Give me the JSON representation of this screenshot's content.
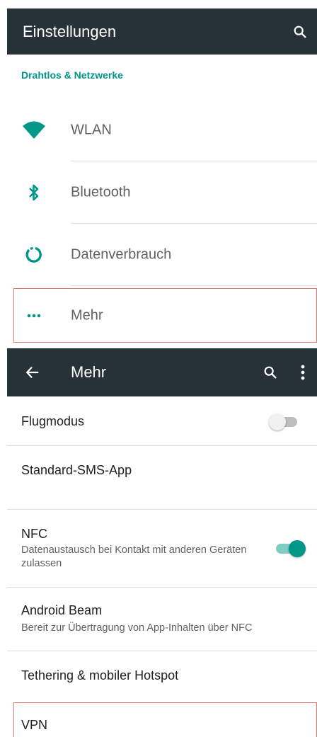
{
  "settings_screen": {
    "title": "Einstellungen",
    "search_icon": "search-icon",
    "section_header": "Drahtlos & Netzwerke",
    "items": [
      {
        "label": "WLAN",
        "icon": "wifi-icon"
      },
      {
        "label": "Bluetooth",
        "icon": "bluetooth-icon"
      },
      {
        "label": "Datenverbrauch",
        "icon": "data-usage-icon"
      },
      {
        "label": "Mehr",
        "icon": "more-horiz-icon"
      }
    ]
  },
  "more_screen": {
    "title": "Mehr",
    "back_icon": "arrow-back-icon",
    "search_icon": "search-icon",
    "overflow_icon": "more-vert-icon",
    "items": [
      {
        "title": "Flugmodus",
        "toggle": false
      },
      {
        "title": "Standard-SMS-App"
      },
      {
        "title": "NFC",
        "summary": "Datenaustausch bei Kontakt mit anderen Geräten zulassen",
        "toggle": true
      },
      {
        "title": "Android Beam",
        "summary": "Bereit zur Übertragung von App-Inhalten über NFC"
      },
      {
        "title": "Tethering & mobiler Hotspot"
      },
      {
        "title": "VPN"
      }
    ]
  },
  "colors": {
    "appbar": "#263238",
    "accent": "#009688",
    "highlight": "#e57373"
  }
}
